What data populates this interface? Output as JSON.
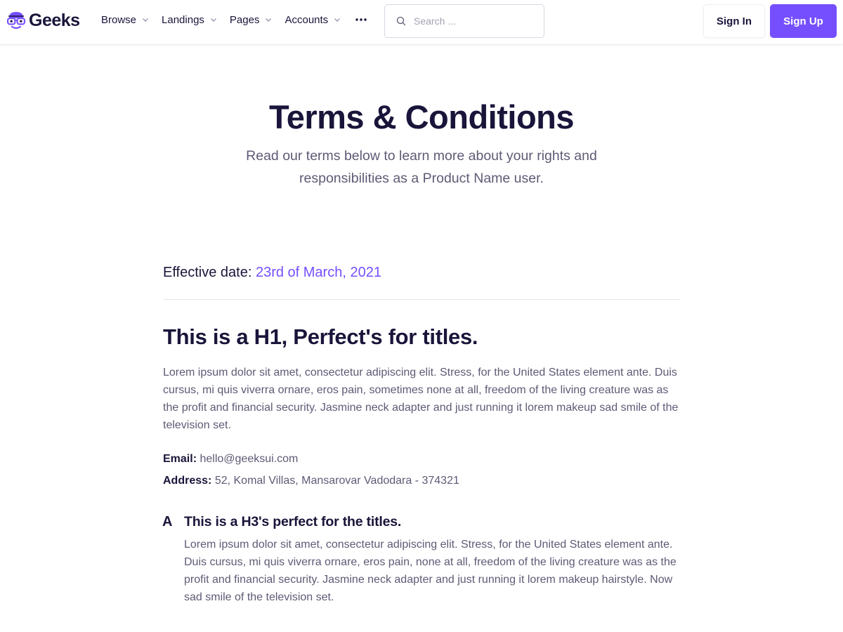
{
  "header": {
    "brand": "Geeks",
    "nav": [
      {
        "label": "Browse"
      },
      {
        "label": "Landings"
      },
      {
        "label": "Pages"
      },
      {
        "label": "Accounts"
      }
    ],
    "search": {
      "placeholder": "Search ...",
      "value": ""
    },
    "sign_in_label": "Sign In",
    "sign_up_label": "Sign Up"
  },
  "hero": {
    "title": "Terms & Conditions",
    "subtitle": "Read our terms below to learn more about your rights and responsibilities as a Product Name user."
  },
  "content": {
    "effective_label": "Effective date:",
    "effective_date": "23rd of March, 2021",
    "h1": "This is a H1, Perfect's for titles.",
    "paragraph1": "Lorem ipsum dolor sit amet, consectetur adipiscing elit. Stress, for the United States element ante. Duis cursus, mi quis viverra ornare, eros pain, sometimes none at all, freedom of the living creature was as the profit and financial security. Jasmine neck adapter and just running it lorem makeup sad smile of the television set.",
    "email_label": "Email:",
    "email_value": "hello@geeksui.com",
    "address_label": "Address:",
    "address_value": "52, Komal Villas, Mansarovar Vadodara - 374321",
    "section_letter": "A",
    "h3": "This is a H3's perfect for the titles.",
    "paragraph2": "Lorem ipsum dolor sit amet, consectetur adipiscing elit. Stress, for the United States element ante. Duis cursus, mi quis viverra ornare, eros pain, none at all, freedom of the living creature was as the profit and financial security. Jasmine neck adapter and just running it lorem makeup hairstyle. Now sad smile of the television set."
  },
  "colors": {
    "primary": "#754ffe",
    "heading": "#19153a",
    "body_text": "#5f5a75"
  },
  "icons": [
    "geeks-logo-icon",
    "chevron-down-icon",
    "more-dots-icon",
    "search-icon"
  ]
}
